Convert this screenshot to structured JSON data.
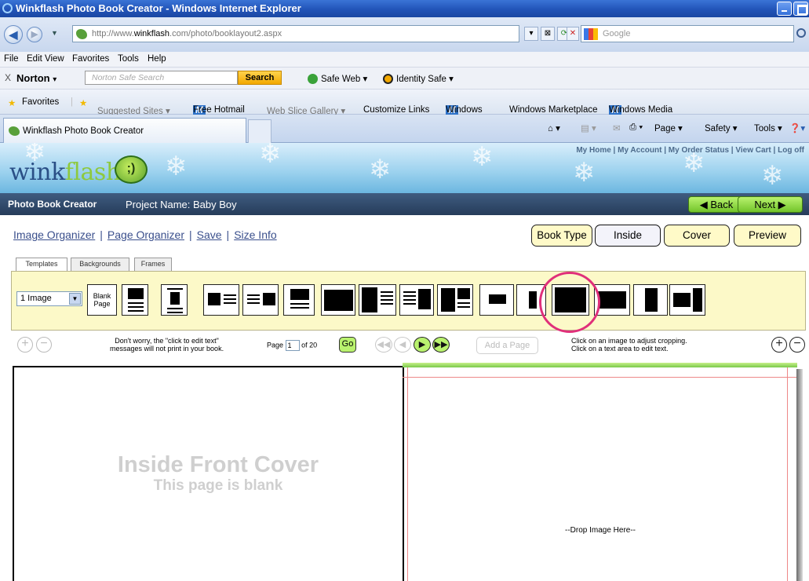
{
  "window": {
    "title": "Winkflash Photo Book Creator - Windows Internet Explorer"
  },
  "browser": {
    "url_prefix": "http://www.",
    "url_domain": "winkflash",
    "url_suffix": ".com/photo/booklayout2.aspx",
    "search_placeholder": "Google",
    "menu": [
      "File",
      "Edit",
      "View",
      "Favorites",
      "Tools",
      "Help"
    ],
    "norton": {
      "close": "X",
      "brand": "Norton",
      "brand_arrow": "▾",
      "search_placeholder": "Norton Safe Search",
      "search_button": "Search",
      "safe_web": "Safe Web ▾",
      "identity_safe": "Identity Safe ▾"
    },
    "favorites": {
      "label": "Favorites",
      "suggested": "Suggested Sites ▾",
      "hotmail": "Free Hotmail",
      "slice": "Web Slice Gallery ▾",
      "customize": "Customize Links",
      "windows": "Windows",
      "marketplace": "Windows Marketplace",
      "media": "Windows Media"
    },
    "tab_title": "Winkflash Photo Book Creator",
    "commands": {
      "page": "Page ▾",
      "safety": "Safety ▾",
      "tools": "Tools ▾"
    }
  },
  "site": {
    "logo_a": "wink",
    "logo_b": "flash",
    "top_links": "My Home  |  My Account  |  My Order Status  |  View Cart  |  Log off"
  },
  "creator": {
    "title": "Photo Book Creator",
    "project": "Project Name: Baby Boy",
    "back": "◀ Back",
    "next": "Next ▶",
    "links": [
      "Image Organizer",
      "Page Organizer",
      "Save",
      "Size Info"
    ],
    "steps": [
      "Book Type",
      "Inside",
      "Cover",
      "Preview"
    ],
    "active_step": "Inside",
    "subtabs": [
      "Templates",
      "Backgrounds",
      "Frames"
    ],
    "image_count": "1 Image",
    "blank_label_1": "Blank",
    "blank_label_2": "Page",
    "hint_left_1": "Don't worry, the \"click to edit text\"",
    "hint_left_2": "messages will not print in your book.",
    "page_label": "Page",
    "page_value": "1",
    "page_total": "of 20",
    "go": "Go",
    "add_page": "Add a Page",
    "hint_right_1": "Click on an image to adjust cropping.",
    "hint_right_2": "Click on a text area to edit text."
  },
  "pages": {
    "left_title": "Inside Front Cover",
    "left_sub": "This page is blank",
    "drop": "--Drop Image Here--"
  },
  "colors": {
    "accent_green": "#9bdc4f",
    "highlight_circle": "#e0307a",
    "link": "#3a4f8c"
  }
}
